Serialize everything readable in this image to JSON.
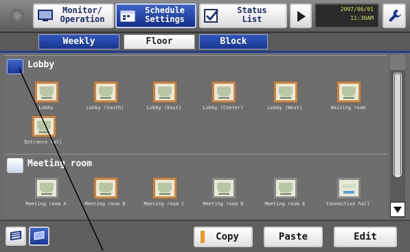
{
  "topbar": {
    "buttons": [
      {
        "label": "Monitor/\nOperation",
        "icon": "monitor-icon"
      },
      {
        "label": "Schedule\nSettings",
        "icon": "calendar-icon"
      },
      {
        "label": "Status\nList",
        "icon": "checklist-icon"
      }
    ],
    "clock": {
      "date": "2007/06/01",
      "time": "11:30AM"
    },
    "accent": "#1b3796"
  },
  "tabs": [
    "Weekly",
    "Floor",
    "Block"
  ],
  "selected_tab": "Floor",
  "groups": [
    {
      "title": "Lobby",
      "units": [
        "Lobby",
        "Lobby (South)",
        "Lobby (East)",
        "Lobby (Center)",
        "Lobby (West)",
        "Waiting room",
        "Entrance hall"
      ]
    },
    {
      "title": "Meeting room",
      "units": [
        "Meeting room A",
        "Meeting room B",
        "Meeting room C",
        "Meeting room D",
        "Meeting room E",
        "Connection hall"
      ]
    }
  ],
  "bottom": {
    "copy": "Copy",
    "paste": "Paste",
    "edit": "Edit"
  },
  "colors": {
    "unit_border_on": "#d2843a",
    "unit_border_off": "#8a8a8a",
    "tab_blue": "#1f3f95"
  }
}
